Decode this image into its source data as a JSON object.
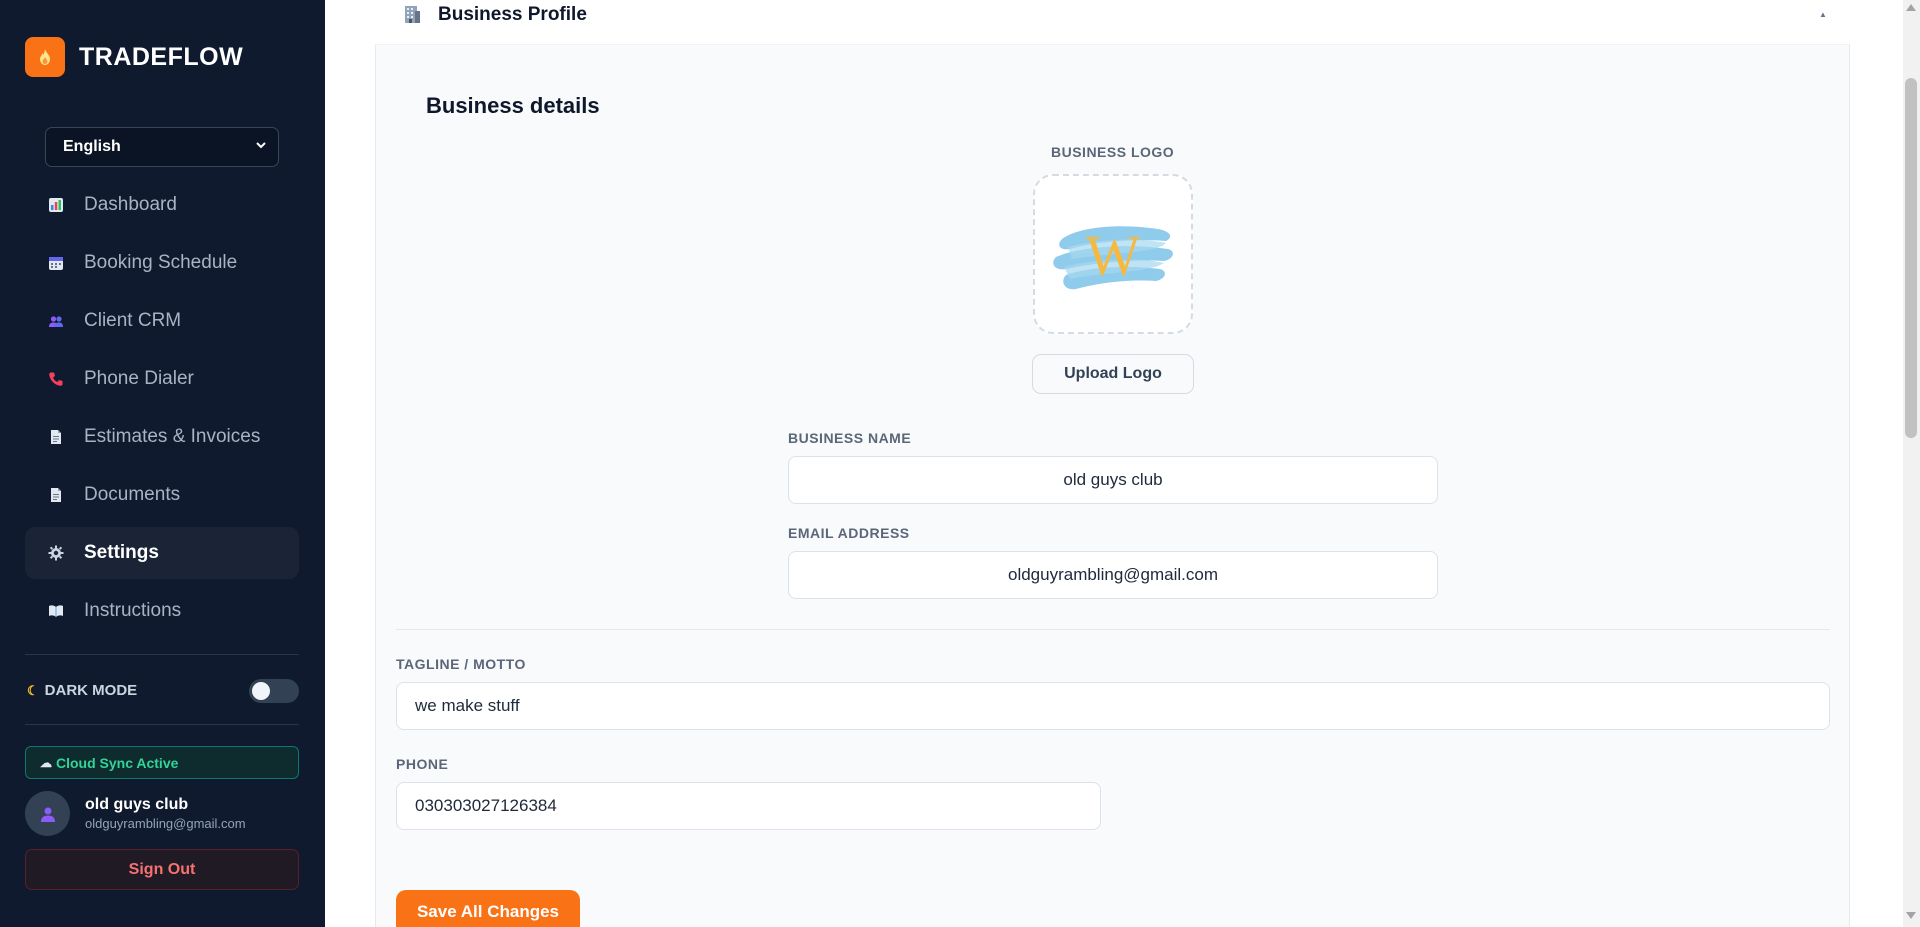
{
  "brand": {
    "name": "TRADEFLOW",
    "icon": "flame-icon"
  },
  "language": {
    "selected": "English"
  },
  "sidebar": {
    "items": [
      {
        "label": "Dashboard",
        "icon": "bar-chart-icon"
      },
      {
        "label": "Booking Schedule",
        "icon": "calendar-icon"
      },
      {
        "label": "Client CRM",
        "icon": "users-icon"
      },
      {
        "label": "Phone Dialer",
        "icon": "phone-icon"
      },
      {
        "label": "Estimates & Invoices",
        "icon": "document-icon"
      },
      {
        "label": "Documents",
        "icon": "document-icon"
      },
      {
        "label": "Settings",
        "icon": "gear-icon",
        "active": true
      },
      {
        "label": "Instructions",
        "icon": "book-icon"
      }
    ],
    "dark_mode_label": "DARK MODE",
    "dark_mode_on": false,
    "sync_status": "Cloud Sync Active",
    "user": {
      "name": "old guys club",
      "email": "oldguyrambling@gmail.com"
    },
    "sign_out_label": "Sign Out"
  },
  "panel": {
    "header_title": "Business Profile",
    "section_title": "Business details",
    "logo_label": "BUSINESS LOGO",
    "logo_letter": "W",
    "upload_label": "Upload Logo",
    "business_name_label": "BUSINESS NAME",
    "business_name_value": "old guys club",
    "email_label": "EMAIL ADDRESS",
    "email_value": "oldguyrambling@gmail.com",
    "tagline_label": "TAGLINE / MOTTO",
    "tagline_value": "we make stuff",
    "phone_label": "PHONE",
    "phone_value": "030303027126384",
    "save_label": "Save All Changes"
  },
  "colors": {
    "accent": "#f97316",
    "sidebar_bg": "#0f1a2e",
    "sync_green": "#34d399",
    "danger": "#f87171"
  }
}
